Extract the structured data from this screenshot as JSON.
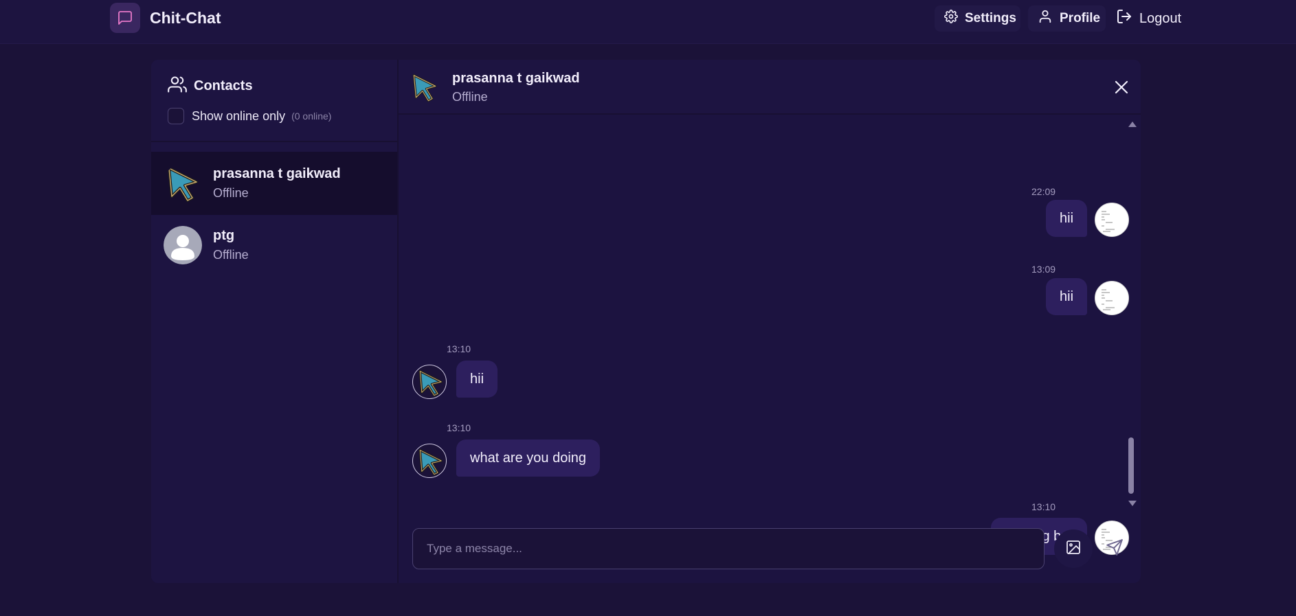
{
  "app": {
    "name": "Chit-Chat",
    "brand_color": "#e879c9"
  },
  "header": {
    "settings_label": "Settings",
    "profile_label": "Profile",
    "logout_label": "Logout"
  },
  "sidebar": {
    "title": "Contacts",
    "show_online_label": "Show online only",
    "online_count": "(0 online)",
    "contacts": [
      {
        "name": "prasanna t gaikwad",
        "status": "Offline",
        "avatar": "cursor-arrow-avatar",
        "active": true
      },
      {
        "name": "ptg",
        "status": "Offline",
        "avatar": "default-user-avatar",
        "active": false
      }
    ]
  },
  "chat": {
    "contact_name": "prasanna t gaikwad",
    "contact_status": "Offline",
    "messages": [
      {
        "time": "22:09",
        "text": "hii",
        "direction": "outgoing"
      },
      {
        "time": "13:09",
        "text": "hii",
        "direction": "outgoing"
      },
      {
        "time": "13:10",
        "text": "hii",
        "direction": "incoming"
      },
      {
        "time": "13:10",
        "text": "what are you doing",
        "direction": "incoming"
      },
      {
        "time": "13:10",
        "text": "nothing bro",
        "direction": "outgoing"
      }
    ],
    "input_placeholder": "Type a message..."
  },
  "colors": {
    "background": "#1b1238",
    "bubble": "#2d1f5e",
    "accent_cursor": "#3a9bb8"
  }
}
